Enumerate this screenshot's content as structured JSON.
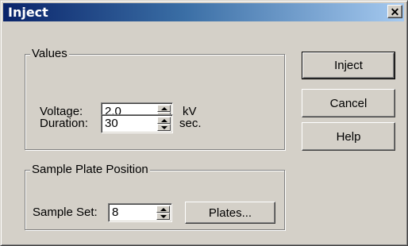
{
  "window": {
    "title": "Inject",
    "close_glyph": "✕"
  },
  "values_group": {
    "legend": "Values",
    "voltage": {
      "label": "Voltage:",
      "value": "2.0",
      "unit": "kV"
    },
    "duration": {
      "label": "Duration:",
      "value": "30",
      "unit": "sec."
    }
  },
  "plate_group": {
    "legend": "Sample Plate Position",
    "sample_set": {
      "label": "Sample Set:",
      "value": "8"
    },
    "plates_button": "Plates..."
  },
  "buttons": {
    "inject": "Inject",
    "cancel": "Cancel",
    "help": "Help"
  },
  "icons": {
    "close": "close-icon",
    "spin_up": "triangle-up-icon",
    "spin_down": "triangle-down-icon"
  }
}
